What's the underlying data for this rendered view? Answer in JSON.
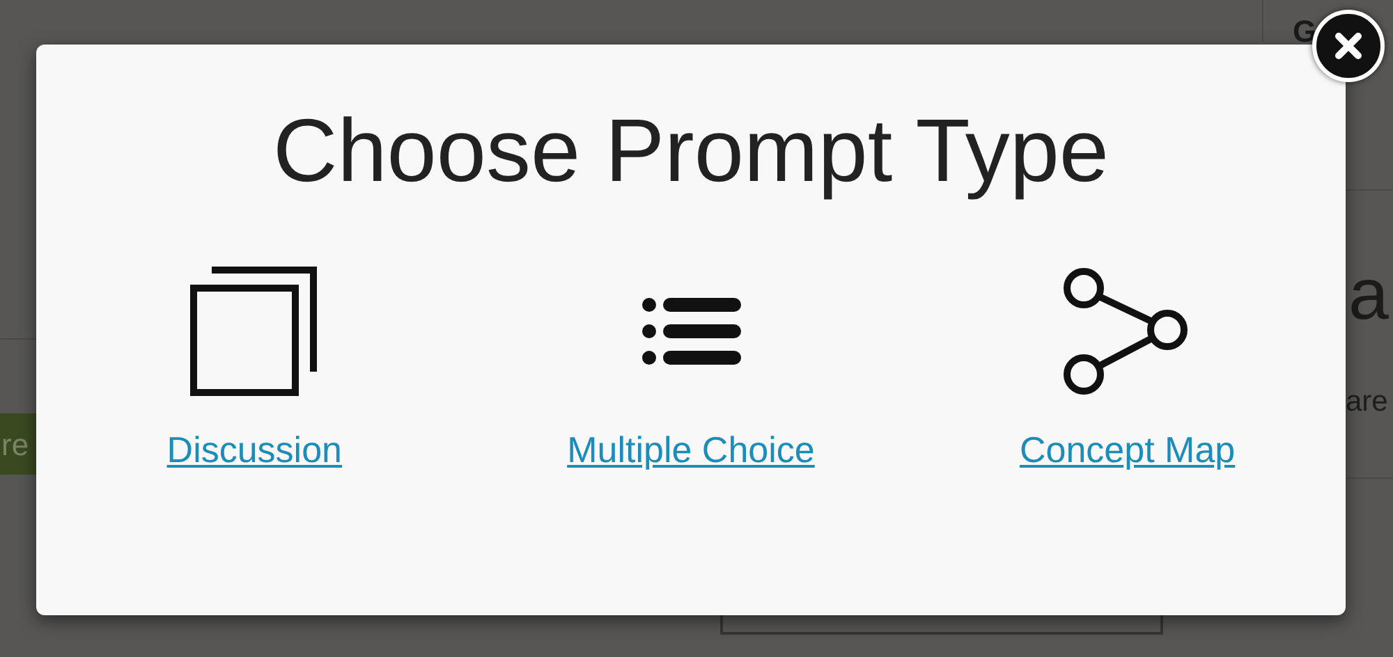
{
  "background": {
    "corner_label": "G",
    "heading": "a",
    "text": "are",
    "button": "re"
  },
  "dialog": {
    "title": "Choose Prompt Type",
    "options": [
      {
        "kind": "discussion",
        "label": "Discussion"
      },
      {
        "kind": "multiple_choice",
        "label": "Multiple Choice"
      },
      {
        "kind": "concept_map",
        "label": "Concept Map"
      }
    ]
  }
}
